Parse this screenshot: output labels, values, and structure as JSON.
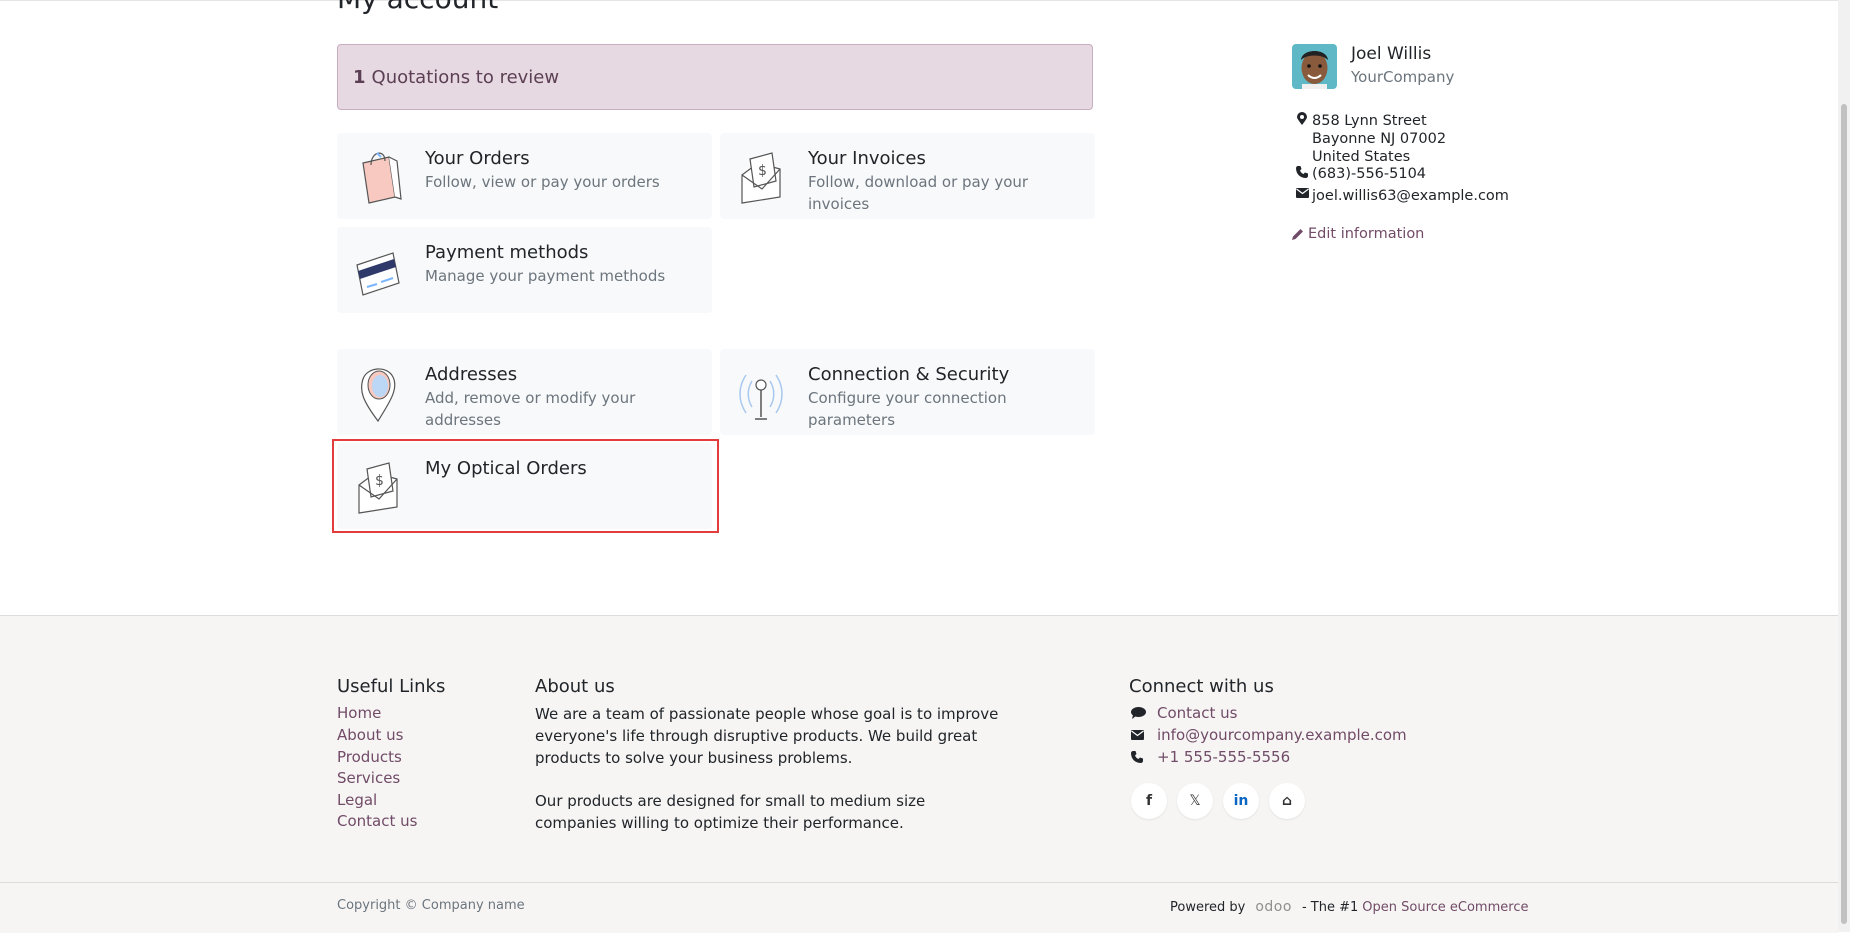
{
  "page": {
    "title": "My account"
  },
  "alert": {
    "count": "1",
    "text": "Quotations to review"
  },
  "cards": [
    {
      "title": "Your Orders",
      "subtitle": "Follow, view or pay your orders"
    },
    {
      "title": "Your Invoices",
      "subtitle": "Follow, download or pay your invoices"
    },
    {
      "title": "Payment methods",
      "subtitle": "Manage your payment methods"
    },
    {
      "title": "Addresses",
      "subtitle": "Add, remove or modify your addresses"
    },
    {
      "title": "Connection & Security",
      "subtitle": "Configure your connection parameters"
    },
    {
      "title": "My Optical Orders",
      "subtitle": ""
    }
  ],
  "profile": {
    "name": "Joel Willis",
    "company": "YourCompany",
    "address_line1": "858 Lynn Street",
    "address_line2": "Bayonne NJ 07002",
    "address_line3": "United States",
    "phone": "(683)-556-5104",
    "email": "joel.willis63@example.com",
    "edit_label": "Edit information"
  },
  "footer": {
    "useful_links_title": "Useful Links",
    "useful_links": [
      "Home",
      "About us",
      "Products",
      "Services",
      "Legal",
      "Contact us"
    ],
    "about_title": "About us",
    "about_p1": "We are a team of passionate people whose goal is to improve everyone's life through disruptive products. We build great products to solve your business problems.",
    "about_p2": "Our products are designed for small to medium size companies willing to optimize their performance.",
    "connect_title": "Connect with us",
    "contact_label": "Contact us",
    "contact_email": "info@yourcompany.example.com",
    "contact_phone": "+1 555-555-5556",
    "social": [
      "f",
      "𝕏",
      "in",
      "⌂"
    ],
    "copyright": "Copyright © Company name",
    "powered_by": "Powered by",
    "odoo": "odoo",
    "tagline_prefix": "- The #1",
    "tagline_link": "Open Source eCommerce"
  },
  "colors": {
    "brand": "#714b67",
    "alert_bg": "#e6d9e2",
    "highlight": "#e23c3c"
  }
}
